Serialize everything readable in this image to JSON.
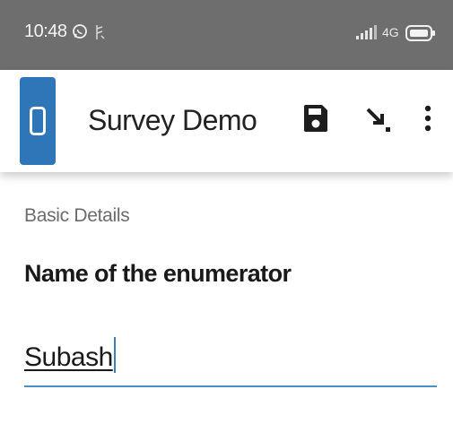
{
  "status_bar": {
    "time": "10:48",
    "network_label": "4G"
  },
  "toolbar": {
    "app_title": "Survey Demo",
    "icons": [
      "app-logo",
      "save-icon",
      "go-to-icon",
      "more-vert-icon"
    ]
  },
  "form": {
    "section_label": "Basic Details",
    "question_label": "Name of the enumerator",
    "answer_value": "Subash"
  },
  "colors": {
    "status_bar": "#6e6e6e",
    "logo_blue": "#2f76b8",
    "field_underline": "#4a90c2"
  }
}
